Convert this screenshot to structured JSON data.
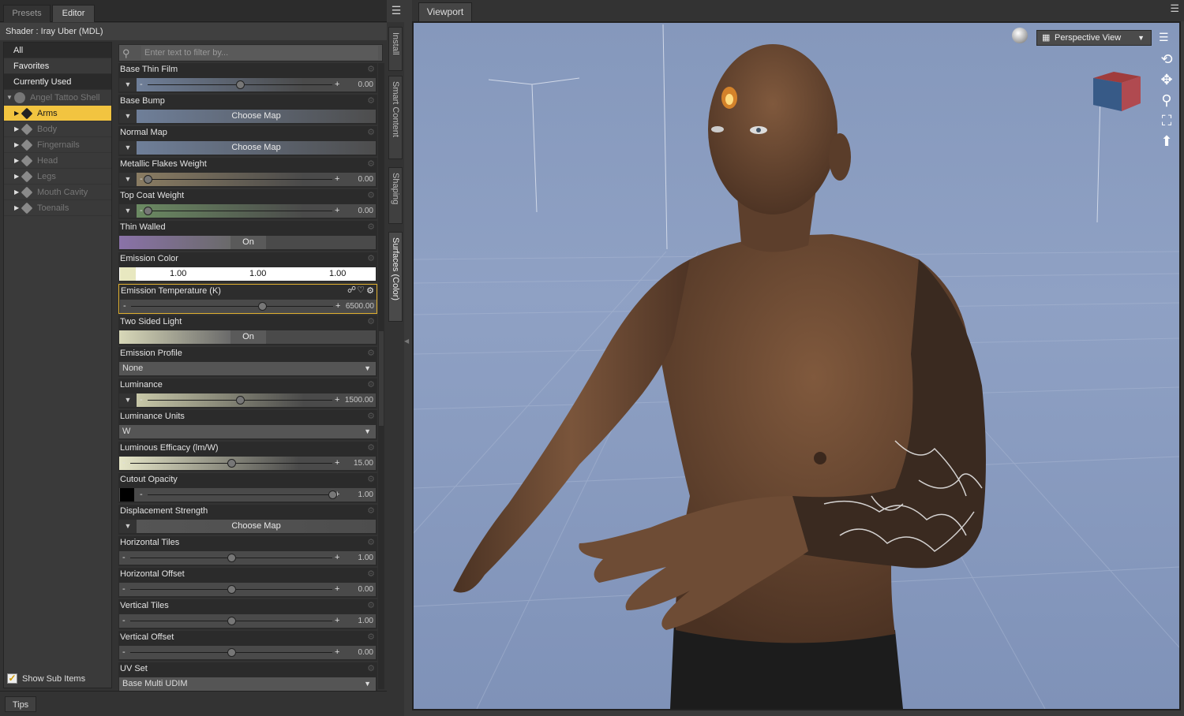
{
  "panel": {
    "tabs": [
      "Presets",
      "Editor"
    ],
    "active_tab": "Editor",
    "shader_line": "Shader :  Iray Uber (MDL)",
    "filter_placeholder": "Enter text to filter by...",
    "tree_items": [
      "All",
      "Favorites",
      "Currently Used"
    ],
    "tree_root": "Angel Tattoo Shell",
    "tree_nodes": [
      "Arms",
      "Body",
      "Fingernails",
      "Head",
      "Legs",
      "Mouth Cavity",
      "Toenails"
    ],
    "selected_node": "Arms",
    "show_sub_items": "Show Sub Items",
    "tips_tab": "Tips"
  },
  "properties": [
    {
      "label": "Base Thin Film",
      "kind": "slider",
      "value": "0.00",
      "level": 0.5,
      "swatch": "#6f7f99",
      "dropdown": true
    },
    {
      "label": "Base Bump",
      "kind": "map",
      "value": "Choose Map",
      "swatch": "#6f7f99"
    },
    {
      "label": "Normal Map",
      "kind": "map",
      "value": "Choose Map",
      "swatch": "#6f7f99"
    },
    {
      "label": "Metallic Flakes Weight",
      "kind": "slider",
      "value": "0.00",
      "level": 0.0,
      "swatch": "#8a7c62",
      "dropdown": true
    },
    {
      "label": "Top Coat Weight",
      "kind": "slider",
      "value": "0.00",
      "level": 0.0,
      "swatch": "#6b8a62",
      "dropdown": true
    },
    {
      "label": "Thin Walled",
      "kind": "toggle",
      "value": "On",
      "swatch": "#8a72a8"
    },
    {
      "label": "Emission Color",
      "kind": "color",
      "values": [
        "1.00",
        "1.00",
        "1.00"
      ]
    },
    {
      "label": "Emission Temperature (K)",
      "kind": "slider",
      "value": "6500.00",
      "level": 0.65,
      "highlighted": true
    },
    {
      "label": "Two Sided Light",
      "kind": "toggle",
      "value": "On",
      "swatch": "#d8d8b8"
    },
    {
      "label": "Emission Profile",
      "kind": "dropdown",
      "value": "None"
    },
    {
      "label": "Luminance",
      "kind": "slider",
      "value": "1500.00",
      "level": 0.5,
      "swatch": "#c8c8a8",
      "dropdown": true
    },
    {
      "label": "Luminance Units",
      "kind": "dropdown",
      "value": "W"
    },
    {
      "label": "Luminous Efficacy (lm/W)",
      "kind": "slider",
      "value": "15.00",
      "level": 0.5,
      "swatch": "#e6e6c8"
    },
    {
      "label": "Cutout Opacity",
      "kind": "slider",
      "value": "1.00",
      "level": 1.0,
      "black": true
    },
    {
      "label": "Displacement Strength",
      "kind": "map",
      "value": "Choose Map",
      "swatch": "#555555"
    },
    {
      "label": "Horizontal Tiles",
      "kind": "slider",
      "value": "1.00",
      "level": 0.5
    },
    {
      "label": "Horizontal Offset",
      "kind": "slider",
      "value": "0.00",
      "level": 0.5
    },
    {
      "label": "Vertical Tiles",
      "kind": "slider",
      "value": "1.00",
      "level": 0.5
    },
    {
      "label": "Vertical Offset",
      "kind": "slider",
      "value": "0.00",
      "level": 0.5
    },
    {
      "label": "UV Set",
      "kind": "dropdown",
      "value": "Base Multi UDIM"
    }
  ],
  "side_tabs": [
    "Install",
    "Smart Content",
    "Shaping",
    "Surfaces (Color)"
  ],
  "viewport": {
    "tab": "Viewport",
    "view_mode": "Perspective View"
  },
  "colors": {
    "accent": "#f2c440",
    "viewport_bg": "#8799bd",
    "skin": "#6a4a33"
  },
  "icons": [
    "search-icon",
    "gear-icon",
    "menu-icon",
    "light-sphere-icon",
    "orbit-icon",
    "pan-icon",
    "zoom-icon",
    "frame-icon",
    "reset-view-icon",
    "nav-cube-icon"
  ]
}
